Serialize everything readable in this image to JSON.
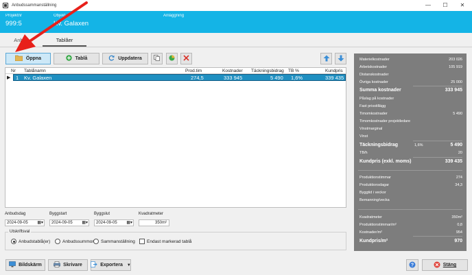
{
  "window": {
    "title": "Anbudssammanställning",
    "minimize_icon": "minimize-icon",
    "maximize_icon": "maximize-icon",
    "close_icon": "close-icon"
  },
  "header": {
    "projekt_label": "Projektnr",
    "projekt_value": "999:5",
    "objekt_label": "Objekt",
    "objekt_value": "Kv. Galaxen",
    "anlaggning_label": "Anläggning",
    "background": "#14b4e6"
  },
  "tabs": [
    {
      "label": "Anbu"
    },
    {
      "label": "Tablåer"
    }
  ],
  "toolbar": {
    "open_label": "Öppna",
    "tabla_label": "Tablå",
    "update_label": "Uppdatera"
  },
  "grid": {
    "columns": [
      "Nr",
      "Tablånamn",
      "Prod.tim",
      "Kostnader",
      "Täckningsbidrag",
      "TB %",
      "Kundpris"
    ],
    "rows": [
      {
        "nr": "1",
        "name": "Kv. Galaxen",
        "prodtim": "274,5",
        "kostnader": "333 945",
        "tb": "5 490",
        "tbp": "1,6%",
        "kundpris": "339 435"
      }
    ]
  },
  "dates": {
    "anbudsdag_label": "Anbudsdag",
    "anbudsdag": "2024-09-05",
    "byggstart_label": "Byggstart",
    "byggstart": "2024-09-05",
    "byggslut_label": "Byggslut",
    "byggslut": "2024-09-05",
    "kvm_label": "Kvadratmeter",
    "kvm": "350m²"
  },
  "print": {
    "legend": "Utskriftsval",
    "opt1": "Anbudstablå(er)",
    "opt2": "Anbudssummor",
    "opt3": "Sammanställning",
    "check": "Endast markerad tablå"
  },
  "bottom": {
    "screen_label": "Bildskärm",
    "printer_label": "Skrivare",
    "export_label": "Exportera",
    "close_label": "Stäng"
  },
  "summary": {
    "materialkostnader": {
      "label": "Materielkostnader",
      "value": "203 026"
    },
    "arbetskostnader": {
      "label": "Arbetskostnader",
      "value": "105 919"
    },
    "distanskostnader": {
      "label": "Distanskostnader",
      "value": ""
    },
    "ovriga": {
      "label": "Övriga kostnader",
      "value": "25 000"
    },
    "summa": {
      "label": "Summa kostnader",
      "value": "333 945"
    },
    "paslag": {
      "label": "Påslag på kostnader"
    },
    "fast": {
      "label": "Fast prisstillägg"
    },
    "timomk": {
      "label": "Timomkostnader",
      "value": "5 490"
    },
    "timomk_proj": {
      "label": "Timomkostnader projektledare"
    },
    "vinstmarginal": {
      "label": "Vinstmarginal"
    },
    "vinst": {
      "label": "Vinst"
    },
    "tb": {
      "label": "Täckningsbidrag",
      "pct": "1,6%",
      "value": "5 490"
    },
    "tbh": {
      "label": "TB/h",
      "value": "20"
    },
    "kundpris": {
      "label": "Kundpris (exkl. moms)",
      "value": "339 435"
    },
    "prodtimmar": {
      "label": "Produktionstimmar",
      "value": "274"
    },
    "proddagar": {
      "label": "Produktionsdagar",
      "value": "34,3"
    },
    "byggtid": {
      "label": "Byggtid i veckor"
    },
    "bemanning": {
      "label": "Bemanning/vecka"
    },
    "kvm": {
      "label": "Kvadratmeter",
      "value": "350m²"
    },
    "prodtim_m2": {
      "label": "Produktionstimmar/m²",
      "value": "0,8"
    },
    "kost_m2": {
      "label": "Kostnader/m²",
      "value": "954"
    },
    "kundpris_m2": {
      "label": "Kundpris/m²",
      "value": "970"
    }
  },
  "colors": {
    "header": "#14b4e6",
    "panel": "#7d7d7d",
    "selection": "#1f8fc1",
    "arrow": "#e8201a"
  }
}
